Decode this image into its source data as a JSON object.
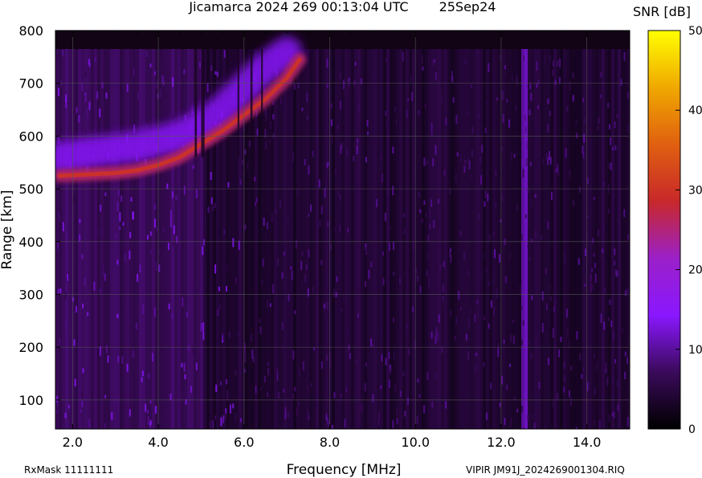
{
  "header": {
    "title": "Jicamarca 2024 269 00:13:04 UTC",
    "date": "25Sep24"
  },
  "footer": {
    "rxmask": "RxMask 11111111",
    "file": "VIPIR  JM91J_2024269001304.RIQ"
  },
  "chart_data": {
    "type": "heatmap",
    "title": "Jicamarca 2024 269 00:13:04 UTC",
    "xlabel": "Frequency [MHz]",
    "ylabel": "Range [km]",
    "xlim": [
      1.6,
      15.0
    ],
    "ylim": [
      45,
      800
    ],
    "x_ticks": [
      2.0,
      4.0,
      6.0,
      8.0,
      10.0,
      12.0,
      14.0
    ],
    "x_tick_labels": [
      "2.0",
      "4.0",
      "6.0",
      "8.0",
      "10.0",
      "12.0",
      "14.0"
    ],
    "y_ticks": [
      100,
      200,
      300,
      400,
      500,
      600,
      700,
      800
    ],
    "y_tick_labels": [
      "100",
      "200",
      "300",
      "400",
      "500",
      "600",
      "700",
      "800"
    ],
    "grid": true,
    "data_range_top_km": 765,
    "colorbar": {
      "label": "SNR [dB]",
      "min": 0,
      "max": 50,
      "ticks": [
        0,
        10,
        20,
        30,
        40,
        50
      ],
      "tick_labels": [
        "0",
        "10",
        "20",
        "30",
        "40",
        "50"
      ],
      "colors": [
        "#000000",
        "#3a0a5a",
        "#8a17ff",
        "#9b20c8",
        "#c8282a",
        "#e06010",
        "#f0a800",
        "#ffff00"
      ]
    },
    "echo_traces": [
      {
        "name": "",
        "points": [
          [
            1.7,
            525
          ],
          [
            2.5,
            528
          ],
          [
            3.0,
            530
          ],
          [
            3.5,
            535
          ],
          [
            4.0,
            545
          ],
          [
            4.5,
            560
          ],
          [
            5.0,
            585
          ],
          [
            5.5,
            610
          ],
          [
            6.0,
            640
          ],
          [
            6.5,
            670
          ],
          [
            7.0,
            710
          ],
          [
            7.3,
            745
          ]
        ],
        "snr": 26
      },
      {
        "name": "",
        "points": [
          [
            1.7,
            560
          ],
          [
            2.5,
            570
          ],
          [
            3.5,
            580
          ],
          [
            4.5,
            600
          ],
          [
            5.0,
            620
          ],
          [
            5.5,
            650
          ],
          [
            6.0,
            690
          ],
          [
            6.5,
            730
          ],
          [
            7.0,
            760
          ]
        ],
        "snr": 14
      }
    ]
  }
}
